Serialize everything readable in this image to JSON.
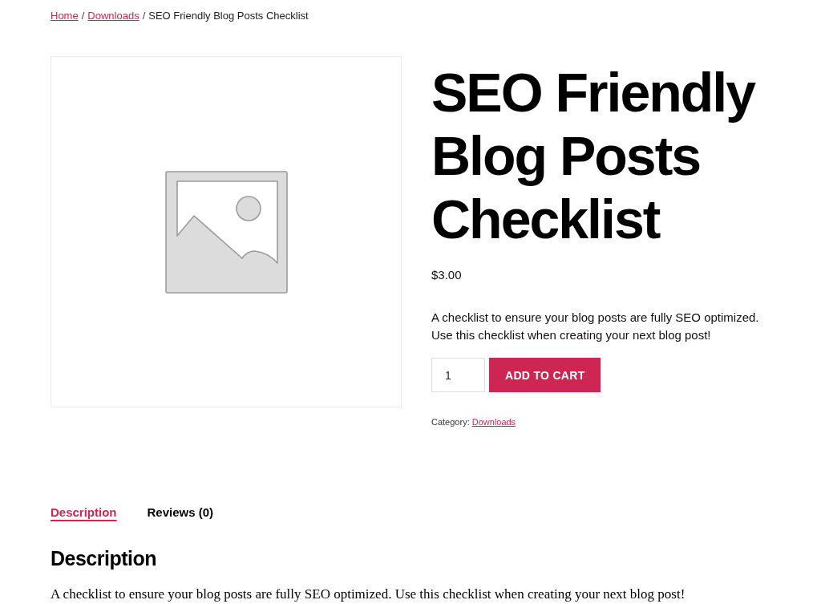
{
  "breadcrumb": [
    {
      "kind": "link",
      "text": "Home"
    },
    {
      "kind": "separator",
      "text": "/"
    },
    {
      "kind": "link",
      "text": "Downloads"
    },
    {
      "kind": "separator",
      "text": "/"
    },
    {
      "kind": "current",
      "text": "SEO Friendly Blog Posts Checklist"
    }
  ],
  "product": {
    "title": "SEO Friendly Blog Posts Checklist",
    "price": "$3.00",
    "short_description": "A checklist to ensure your blog posts are fully SEO optimized. Use this checklist when creating your next blog post!",
    "quantity": "1",
    "add_to_cart": "ADD TO CART",
    "category": {
      "label": "Category:",
      "link": "Downloads"
    }
  },
  "tabs": [
    {
      "label": "Description",
      "selected": true
    },
    {
      "label": "Reviews (0)",
      "selected": false
    }
  ],
  "tab_panel": {
    "heading": "Description",
    "text": "A checklist to ensure your blog posts are fully SEO optimized. Use this checklist when creating your next blog post!"
  }
}
